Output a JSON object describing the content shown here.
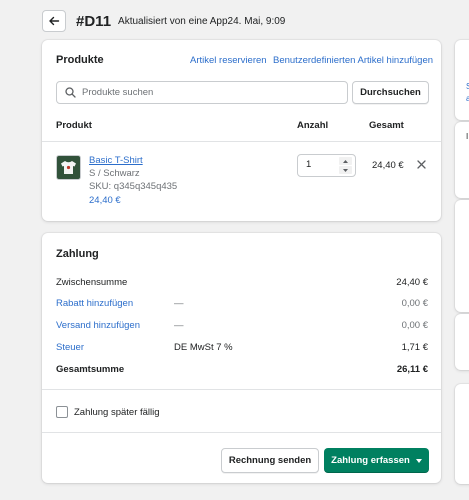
{
  "header": {
    "order_number": "#D11",
    "subtitle": "Aktualisiert von eine App24. Mai, 9:09"
  },
  "products": {
    "title": "Produkte",
    "reserve_link": "Artikel reservieren",
    "custom_link": "Benutzerdefinierten Artikel hinzufügen",
    "search_placeholder": "Produkte suchen",
    "search_button": "Durchsuchen",
    "columns": {
      "product": "Produkt",
      "qty": "Anzahl",
      "total": "Gesamt"
    },
    "items": [
      {
        "name": "Basic T-Shirt",
        "variant": "S / Schwarz",
        "sku": "SKU: q345q345q435",
        "unit_price": "24,40 €",
        "quantity": "1",
        "line_total": "24,40 €"
      }
    ]
  },
  "payment": {
    "title": "Zahlung",
    "rows": {
      "subtotal": {
        "label": "Zwischensumme",
        "value": "24,40 €"
      },
      "discount": {
        "label": "Rabatt hinzufügen",
        "mid": "—",
        "value": "0,00 €"
      },
      "shipping": {
        "label": "Versand hinzufügen",
        "mid": "—",
        "value": "0,00 €"
      },
      "tax": {
        "label": "Steuer",
        "mid": "DE MwSt 7 %",
        "value": "1,71 €"
      },
      "total": {
        "label": "Gesamtsumme",
        "value": "26,11 €"
      }
    },
    "pay_later_label": "Zahlung später fällig",
    "invoice_button": "Rechnung senden",
    "capture_button": "Zahlung erfassen"
  },
  "colors": {
    "accent_link": "#2c6ecb",
    "primary_button": "#008060",
    "background": "#f1f1f1"
  },
  "icons": [
    "arrow-left-icon",
    "search-icon",
    "close-icon",
    "chevron-down-icon",
    "caret-up-icon",
    "caret-down-icon"
  ]
}
